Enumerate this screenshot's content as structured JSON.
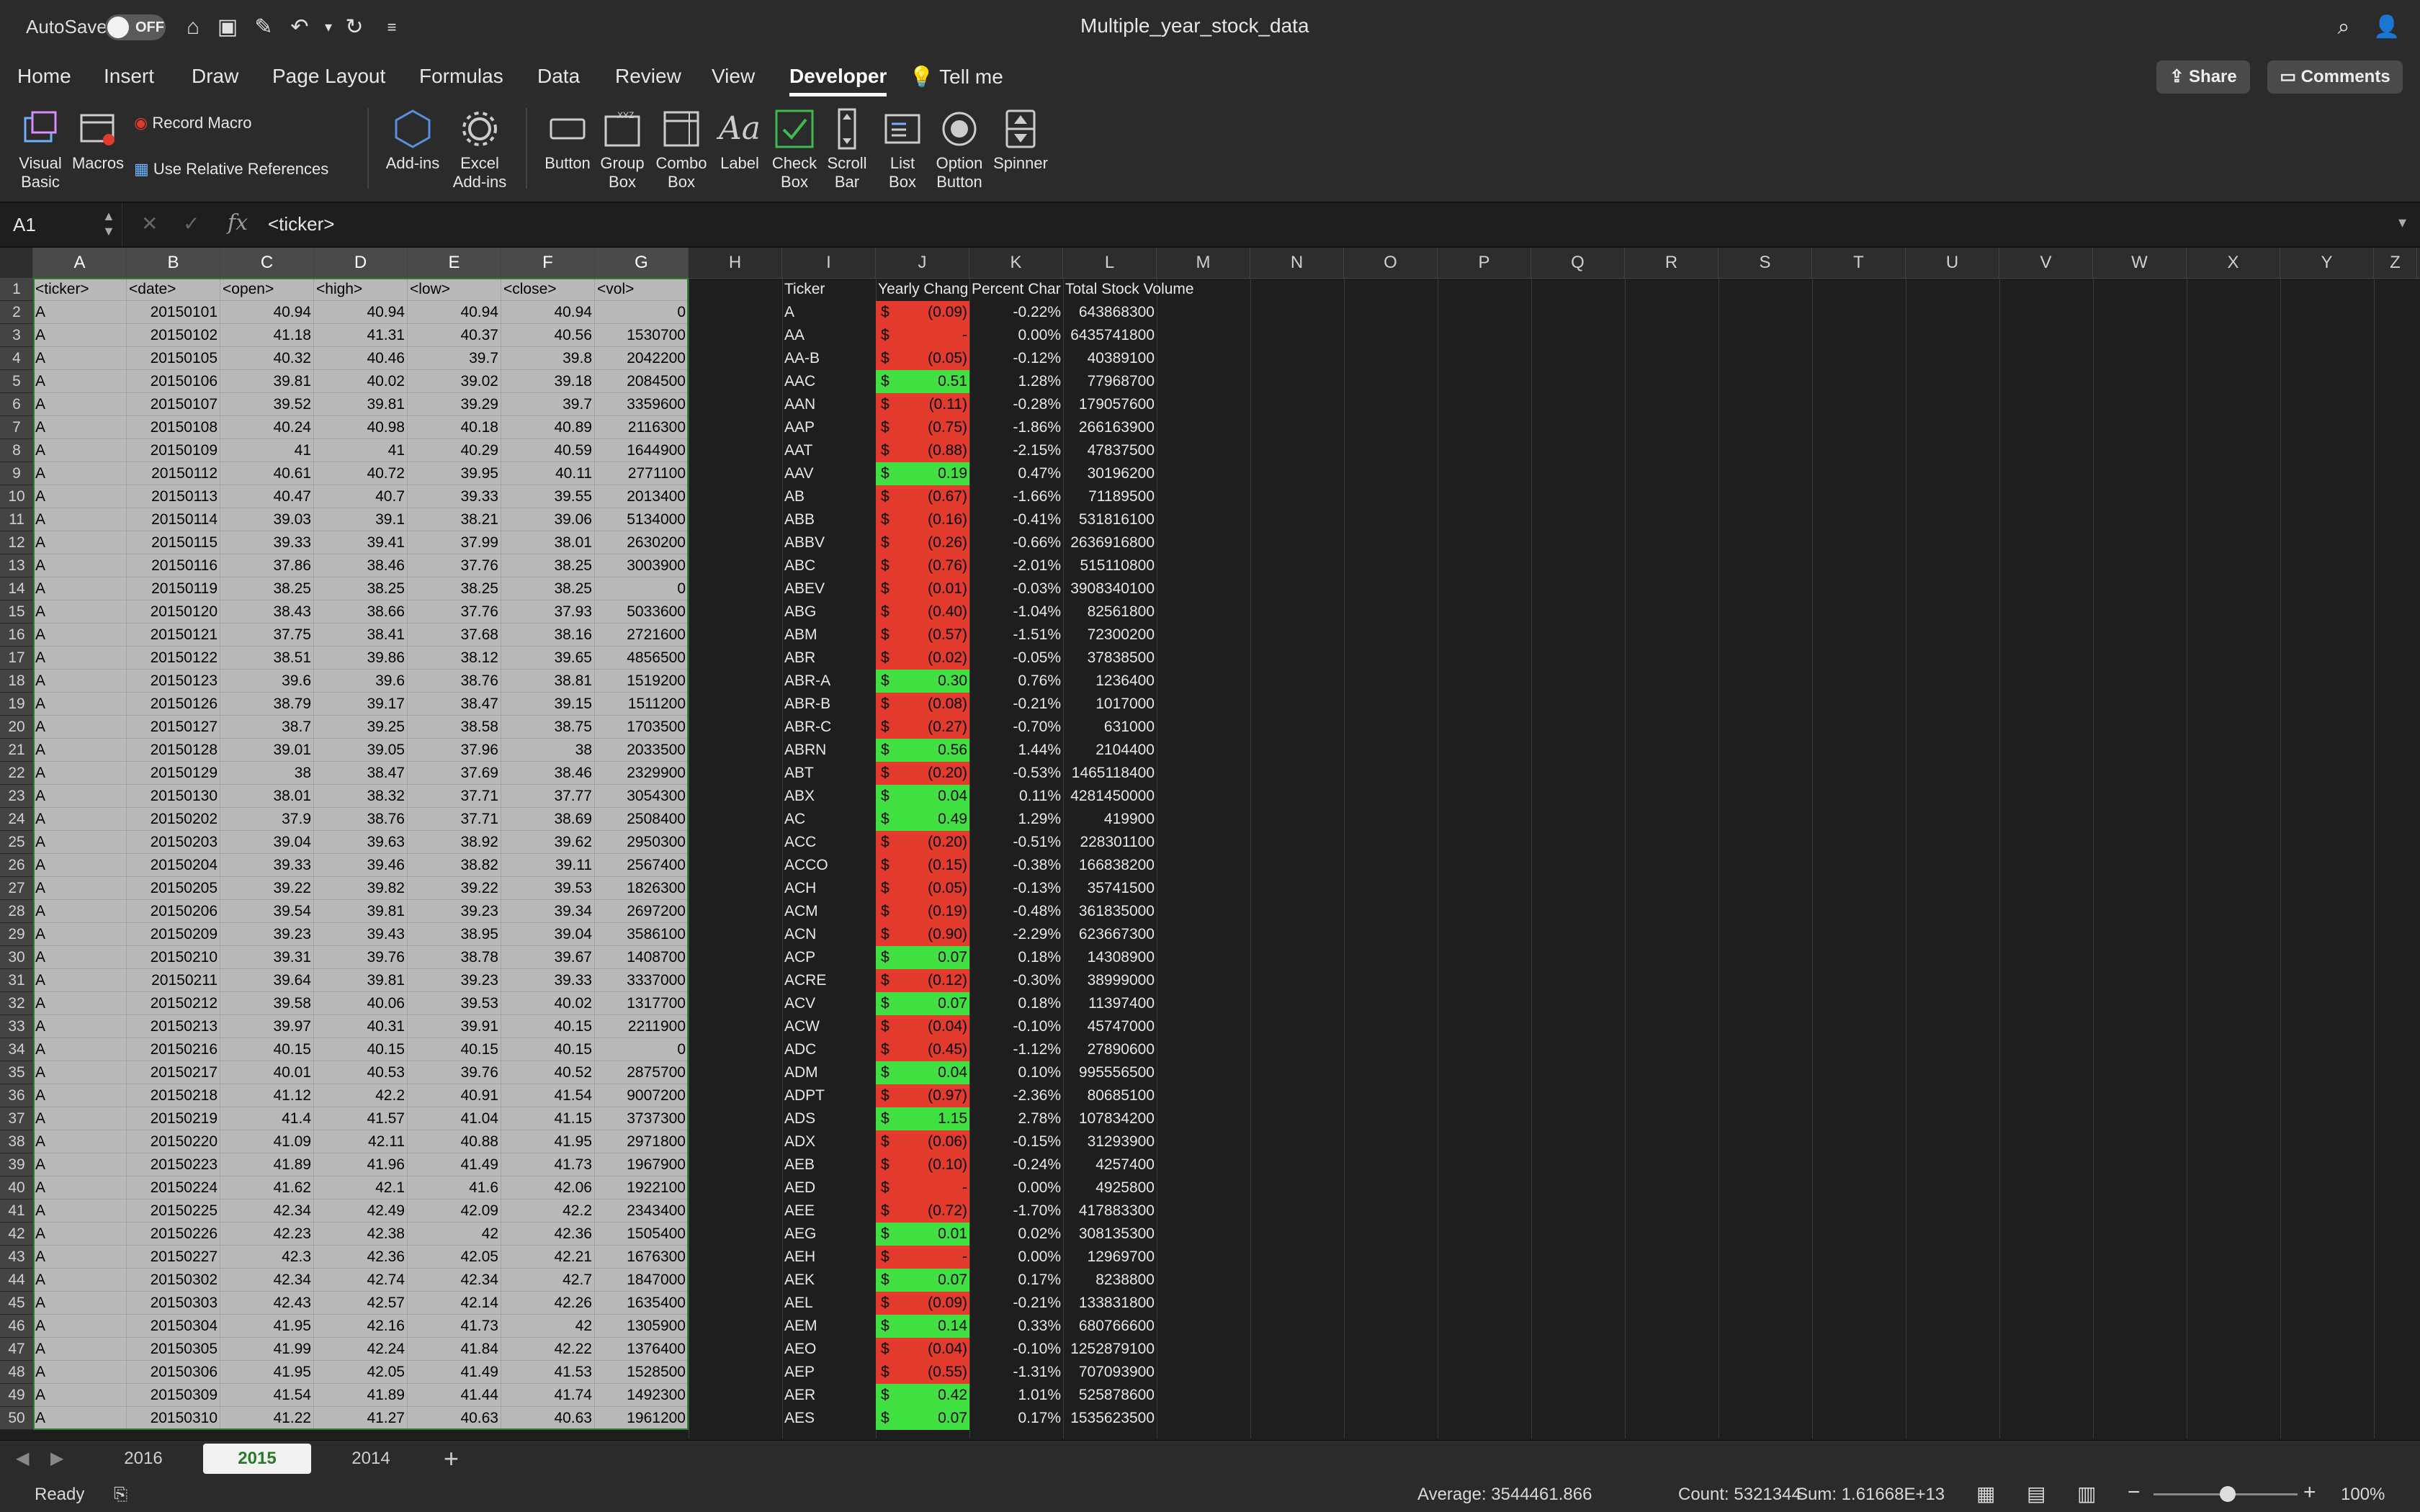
{
  "titlebar": {
    "autosave_label": "AutoSave",
    "autosave_state": "OFF",
    "doc_title": "Multiple_year_stock_data"
  },
  "ribbon_tabs": [
    "Home",
    "Insert",
    "Draw",
    "Page Layout",
    "Formulas",
    "Data",
    "Review",
    "View",
    "Developer",
    "Tell me"
  ],
  "active_tab": "Developer",
  "share_label": "Share",
  "comments_label": "Comments",
  "ribbon": {
    "visual_basic": "Visual\nBasic",
    "macros": "Macros",
    "record_macro": "Record Macro",
    "use_relative": "Use Relative References",
    "addins": "Add-ins",
    "excel_addins": "Excel\nAdd-ins",
    "button": "Button",
    "group_box": "Group\nBox",
    "combo_box": "Combo\nBox",
    "label": "Label",
    "check_box": "Check\nBox",
    "scroll_bar": "Scroll\nBar",
    "list_box": "List\nBox",
    "option_button": "Option\nButton",
    "spinner": "Spinner"
  },
  "formula_bar": {
    "name_box": "A1",
    "formula": "<ticker>"
  },
  "columns": [
    "A",
    "B",
    "C",
    "D",
    "E",
    "F",
    "G",
    "H",
    "I",
    "J",
    "K",
    "L",
    "M",
    "N",
    "O",
    "P",
    "Q",
    "R",
    "S",
    "T",
    "U",
    "V",
    "W",
    "X",
    "Y",
    "Z"
  ],
  "rows": [
    "1",
    "2",
    "3",
    "4",
    "5",
    "6",
    "7",
    "8",
    "9",
    "10",
    "11",
    "12",
    "13",
    "14",
    "15",
    "16",
    "17",
    "18",
    "19",
    "20",
    "21",
    "22",
    "23",
    "24",
    "25",
    "26",
    "27",
    "28",
    "29",
    "30",
    "31",
    "32",
    "33",
    "34",
    "35",
    "36",
    "37",
    "38",
    "39",
    "40",
    "41",
    "42",
    "43",
    "44",
    "45",
    "46",
    "47",
    "48",
    "49",
    "50"
  ],
  "data_headers": [
    "<ticker>",
    "<date>",
    "<open>",
    "<high>",
    "<low>",
    "<close>",
    "<vol>"
  ],
  "data_rows": [
    [
      "A",
      "20150101",
      "40.94",
      "40.94",
      "40.94",
      "40.94",
      "0"
    ],
    [
      "A",
      "20150102",
      "41.18",
      "41.31",
      "40.37",
      "40.56",
      "1530700"
    ],
    [
      "A",
      "20150105",
      "40.32",
      "40.46",
      "39.7",
      "39.8",
      "2042200"
    ],
    [
      "A",
      "20150106",
      "39.81",
      "40.02",
      "39.02",
      "39.18",
      "2084500"
    ],
    [
      "A",
      "20150107",
      "39.52",
      "39.81",
      "39.29",
      "39.7",
      "3359600"
    ],
    [
      "A",
      "20150108",
      "40.24",
      "40.98",
      "40.18",
      "40.89",
      "2116300"
    ],
    [
      "A",
      "20150109",
      "41",
      "41",
      "40.29",
      "40.59",
      "1644900"
    ],
    [
      "A",
      "20150112",
      "40.61",
      "40.72",
      "39.95",
      "40.11",
      "2771100"
    ],
    [
      "A",
      "20150113",
      "40.47",
      "40.7",
      "39.33",
      "39.55",
      "2013400"
    ],
    [
      "A",
      "20150114",
      "39.03",
      "39.1",
      "38.21",
      "39.06",
      "5134000"
    ],
    [
      "A",
      "20150115",
      "39.33",
      "39.41",
      "37.99",
      "38.01",
      "2630200"
    ],
    [
      "A",
      "20150116",
      "37.86",
      "38.46",
      "37.76",
      "38.25",
      "3003900"
    ],
    [
      "A",
      "20150119",
      "38.25",
      "38.25",
      "38.25",
      "38.25",
      "0"
    ],
    [
      "A",
      "20150120",
      "38.43",
      "38.66",
      "37.76",
      "37.93",
      "5033600"
    ],
    [
      "A",
      "20150121",
      "37.75",
      "38.41",
      "37.68",
      "38.16",
      "2721600"
    ],
    [
      "A",
      "20150122",
      "38.51",
      "39.86",
      "38.12",
      "39.65",
      "4856500"
    ],
    [
      "A",
      "20150123",
      "39.6",
      "39.6",
      "38.76",
      "38.81",
      "1519200"
    ],
    [
      "A",
      "20150126",
      "38.79",
      "39.17",
      "38.47",
      "39.15",
      "1511200"
    ],
    [
      "A",
      "20150127",
      "38.7",
      "39.25",
      "38.58",
      "38.75",
      "1703500"
    ],
    [
      "A",
      "20150128",
      "39.01",
      "39.05",
      "37.96",
      "38",
      "2033500"
    ],
    [
      "A",
      "20150129",
      "38",
      "38.47",
      "37.69",
      "38.46",
      "2329900"
    ],
    [
      "A",
      "20150130",
      "38.01",
      "38.32",
      "37.71",
      "37.77",
      "3054300"
    ],
    [
      "A",
      "20150202",
      "37.9",
      "38.76",
      "37.71",
      "38.69",
      "2508400"
    ],
    [
      "A",
      "20150203",
      "39.04",
      "39.63",
      "38.92",
      "39.62",
      "2950300"
    ],
    [
      "A",
      "20150204",
      "39.33",
      "39.46",
      "38.82",
      "39.11",
      "2567400"
    ],
    [
      "A",
      "20150205",
      "39.22",
      "39.82",
      "39.22",
      "39.53",
      "1826300"
    ],
    [
      "A",
      "20150206",
      "39.54",
      "39.81",
      "39.23",
      "39.34",
      "2697200"
    ],
    [
      "A",
      "20150209",
      "39.23",
      "39.43",
      "38.95",
      "39.04",
      "3586100"
    ],
    [
      "A",
      "20150210",
      "39.31",
      "39.76",
      "38.78",
      "39.67",
      "1408700"
    ],
    [
      "A",
      "20150211",
      "39.64",
      "39.81",
      "39.23",
      "39.33",
      "3337000"
    ],
    [
      "A",
      "20150212",
      "39.58",
      "40.06",
      "39.53",
      "40.02",
      "1317700"
    ],
    [
      "A",
      "20150213",
      "39.97",
      "40.31",
      "39.91",
      "40.15",
      "2211900"
    ],
    [
      "A",
      "20150216",
      "40.15",
      "40.15",
      "40.15",
      "40.15",
      "0"
    ],
    [
      "A",
      "20150217",
      "40.01",
      "40.53",
      "39.76",
      "40.52",
      "2875700"
    ],
    [
      "A",
      "20150218",
      "41.12",
      "42.2",
      "40.91",
      "41.54",
      "9007200"
    ],
    [
      "A",
      "20150219",
      "41.4",
      "41.57",
      "41.04",
      "41.15",
      "3737300"
    ],
    [
      "A",
      "20150220",
      "41.09",
      "42.11",
      "40.88",
      "41.95",
      "2971800"
    ],
    [
      "A",
      "20150223",
      "41.89",
      "41.96",
      "41.49",
      "41.73",
      "1967900"
    ],
    [
      "A",
      "20150224",
      "41.62",
      "42.1",
      "41.6",
      "42.06",
      "1922100"
    ],
    [
      "A",
      "20150225",
      "42.34",
      "42.49",
      "42.09",
      "42.2",
      "2343400"
    ],
    [
      "A",
      "20150226",
      "42.23",
      "42.38",
      "42",
      "42.36",
      "1505400"
    ],
    [
      "A",
      "20150227",
      "42.3",
      "42.36",
      "42.05",
      "42.21",
      "1676300"
    ],
    [
      "A",
      "20150302",
      "42.34",
      "42.74",
      "42.34",
      "42.7",
      "1847000"
    ],
    [
      "A",
      "20150303",
      "42.43",
      "42.57",
      "42.14",
      "42.26",
      "1635400"
    ],
    [
      "A",
      "20150304",
      "41.95",
      "42.16",
      "41.73",
      "42",
      "1305900"
    ],
    [
      "A",
      "20150305",
      "41.99",
      "42.24",
      "41.84",
      "42.22",
      "1376400"
    ],
    [
      "A",
      "20150306",
      "41.95",
      "42.05",
      "41.49",
      "41.53",
      "1528500"
    ],
    [
      "A",
      "20150309",
      "41.54",
      "41.89",
      "41.44",
      "41.74",
      "1492300"
    ],
    [
      "A",
      "20150310",
      "41.22",
      "41.27",
      "40.63",
      "40.63",
      "1961200"
    ]
  ],
  "summary_headers": [
    "Ticker",
    "Yearly Chang",
    "Percent Char",
    "Total Stock Volume"
  ],
  "summary_rows": [
    [
      "A",
      "(0.09)",
      "-0.22%",
      "643868300",
      "neg"
    ],
    [
      "AA",
      "-",
      "0.00%",
      "6435741800",
      "neg"
    ],
    [
      "AA-B",
      "(0.05)",
      "-0.12%",
      "40389100",
      "neg"
    ],
    [
      "AAC",
      "0.51",
      "1.28%",
      "77968700",
      "pos"
    ],
    [
      "AAN",
      "(0.11)",
      "-0.28%",
      "179057600",
      "neg"
    ],
    [
      "AAP",
      "(0.75)",
      "-1.86%",
      "266163900",
      "neg"
    ],
    [
      "AAT",
      "(0.88)",
      "-2.15%",
      "47837500",
      "neg"
    ],
    [
      "AAV",
      "0.19",
      "0.47%",
      "30196200",
      "pos"
    ],
    [
      "AB",
      "(0.67)",
      "-1.66%",
      "71189500",
      "neg"
    ],
    [
      "ABB",
      "(0.16)",
      "-0.41%",
      "531816100",
      "neg"
    ],
    [
      "ABBV",
      "(0.26)",
      "-0.66%",
      "2636916800",
      "neg"
    ],
    [
      "ABC",
      "(0.76)",
      "-2.01%",
      "515110800",
      "neg"
    ],
    [
      "ABEV",
      "(0.01)",
      "-0.03%",
      "3908340100",
      "neg"
    ],
    [
      "ABG",
      "(0.40)",
      "-1.04%",
      "82561800",
      "neg"
    ],
    [
      "ABM",
      "(0.57)",
      "-1.51%",
      "72300200",
      "neg"
    ],
    [
      "ABR",
      "(0.02)",
      "-0.05%",
      "37838500",
      "neg"
    ],
    [
      "ABR-A",
      "0.30",
      "0.76%",
      "1236400",
      "pos"
    ],
    [
      "ABR-B",
      "(0.08)",
      "-0.21%",
      "1017000",
      "neg"
    ],
    [
      "ABR-C",
      "(0.27)",
      "-0.70%",
      "631000",
      "neg"
    ],
    [
      "ABRN",
      "0.56",
      "1.44%",
      "2104400",
      "pos"
    ],
    [
      "ABT",
      "(0.20)",
      "-0.53%",
      "1465118400",
      "neg"
    ],
    [
      "ABX",
      "0.04",
      "0.11%",
      "4281450000",
      "pos"
    ],
    [
      "AC",
      "0.49",
      "1.29%",
      "419900",
      "pos"
    ],
    [
      "ACC",
      "(0.20)",
      "-0.51%",
      "228301100",
      "neg"
    ],
    [
      "ACCO",
      "(0.15)",
      "-0.38%",
      "166838200",
      "neg"
    ],
    [
      "ACH",
      "(0.05)",
      "-0.13%",
      "35741500",
      "neg"
    ],
    [
      "ACM",
      "(0.19)",
      "-0.48%",
      "361835000",
      "neg"
    ],
    [
      "ACN",
      "(0.90)",
      "-2.29%",
      "623667300",
      "neg"
    ],
    [
      "ACP",
      "0.07",
      "0.18%",
      "14308900",
      "pos"
    ],
    [
      "ACRE",
      "(0.12)",
      "-0.30%",
      "38999000",
      "neg"
    ],
    [
      "ACV",
      "0.07",
      "0.18%",
      "11397400",
      "pos"
    ],
    [
      "ACW",
      "(0.04)",
      "-0.10%",
      "45747000",
      "neg"
    ],
    [
      "ADC",
      "(0.45)",
      "-1.12%",
      "27890600",
      "neg"
    ],
    [
      "ADM",
      "0.04",
      "0.10%",
      "995556500",
      "pos"
    ],
    [
      "ADPT",
      "(0.97)",
      "-2.36%",
      "80685100",
      "neg"
    ],
    [
      "ADS",
      "1.15",
      "2.78%",
      "107834200",
      "pos"
    ],
    [
      "ADX",
      "(0.06)",
      "-0.15%",
      "31293900",
      "neg"
    ],
    [
      "AEB",
      "(0.10)",
      "-0.24%",
      "4257400",
      "neg"
    ],
    [
      "AED",
      "-",
      "0.00%",
      "4925800",
      "neg"
    ],
    [
      "AEE",
      "(0.72)",
      "-1.70%",
      "417883300",
      "neg"
    ],
    [
      "AEG",
      "0.01",
      "0.02%",
      "308135300",
      "pos"
    ],
    [
      "AEH",
      "-",
      "0.00%",
      "12969700",
      "neg"
    ],
    [
      "AEK",
      "0.07",
      "0.17%",
      "8238800",
      "pos"
    ],
    [
      "AEL",
      "(0.09)",
      "-0.21%",
      "133831800",
      "neg"
    ],
    [
      "AEM",
      "0.14",
      "0.33%",
      "680766600",
      "pos"
    ],
    [
      "AEO",
      "(0.04)",
      "-0.10%",
      "1252879100",
      "neg"
    ],
    [
      "AEP",
      "(0.55)",
      "-1.31%",
      "707093900",
      "neg"
    ],
    [
      "AER",
      "0.42",
      "1.01%",
      "525878600",
      "pos"
    ],
    [
      "AES",
      "0.07",
      "0.17%",
      "1535623500",
      "pos"
    ]
  ],
  "sheet_tabs": [
    "2016",
    "2015",
    "2014"
  ],
  "active_sheet": "2015",
  "status": {
    "ready": "Ready",
    "average": "Average: 3544461.866",
    "count": "Count: 5321344",
    "sum": "Sum: 1.61668E+13",
    "zoom": "100%"
  },
  "colors": {
    "negative": "#e23b2e",
    "positive": "#3fe03f"
  }
}
